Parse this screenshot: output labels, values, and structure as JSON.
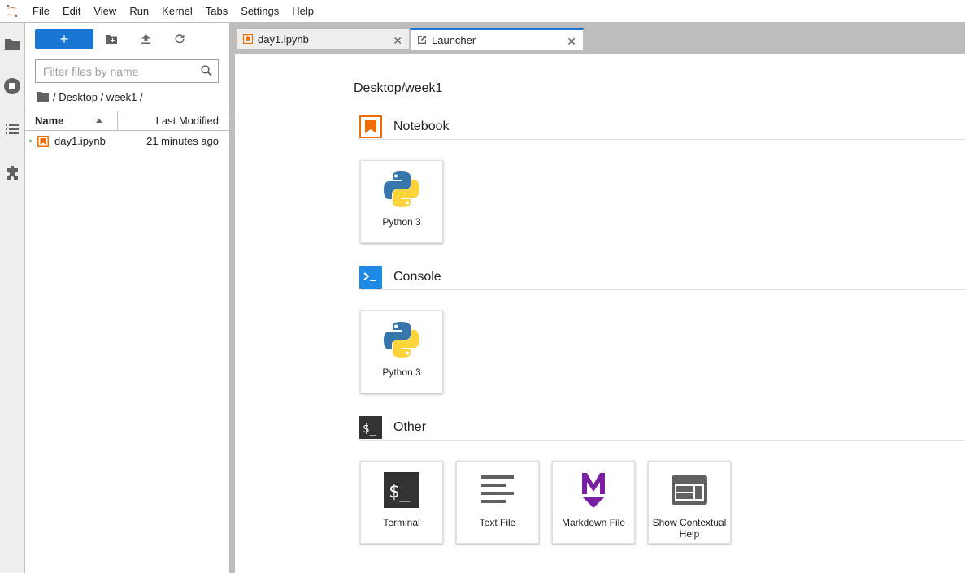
{
  "menubar": {
    "items": [
      "File",
      "Edit",
      "View",
      "Run",
      "Kernel",
      "Tabs",
      "Settings",
      "Help"
    ]
  },
  "filebrowser": {
    "new_label": "+",
    "filter_placeholder": "Filter files by name",
    "breadcrumb": [
      "/",
      "Desktop",
      "/",
      "week1",
      "/"
    ],
    "columns": {
      "name": "Name",
      "modified": "Last Modified"
    },
    "files": [
      {
        "name": "day1.ipynb",
        "modified": "21 minutes ago",
        "running": true
      }
    ]
  },
  "tabs": [
    {
      "label": "day1.ipynb",
      "icon": "notebook-icon",
      "active": false
    },
    {
      "label": "Launcher",
      "icon": "launcher-icon",
      "active": true
    }
  ],
  "launcher": {
    "cwd": "Desktop/week1",
    "sections": [
      {
        "title": "Notebook",
        "cards": [
          {
            "label": "Python 3",
            "icon": "python-icon"
          }
        ]
      },
      {
        "title": "Console",
        "cards": [
          {
            "label": "Python 3",
            "icon": "python-icon"
          }
        ]
      },
      {
        "title": "Other",
        "cards": [
          {
            "label": "Terminal",
            "icon": "terminal-icon"
          },
          {
            "label": "Text File",
            "icon": "text-file-icon"
          },
          {
            "label": "Markdown File",
            "icon": "markdown-icon"
          },
          {
            "label": "Show Contextual Help",
            "icon": "contextual-help-icon"
          }
        ]
      }
    ]
  },
  "colors": {
    "accent": "#1976d2",
    "notebook": "#ef6c00",
    "console": "#1e88e5",
    "markdown": "#7b1fa2"
  }
}
